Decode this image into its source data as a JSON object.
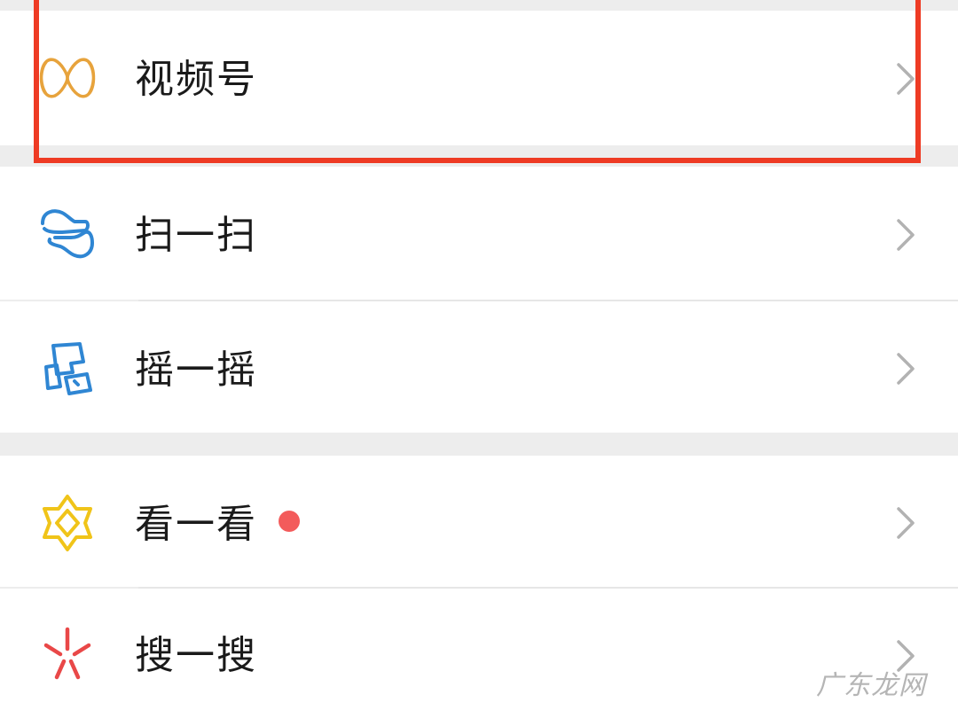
{
  "menu": {
    "items": [
      {
        "label": "视频号",
        "icon": "channels-icon"
      },
      {
        "label": "扫一扫",
        "icon": "scan-icon"
      },
      {
        "label": "摇一摇",
        "icon": "shake-icon"
      },
      {
        "label": "看一看",
        "icon": "top-stories-icon",
        "badge": "red-dot"
      },
      {
        "label": "搜一搜",
        "icon": "search-sparkle-icon"
      }
    ]
  },
  "colors": {
    "highlight_border": "#ee3b24",
    "channels_icon": "#e7a33c",
    "scan_icon": "#2f86d3",
    "shake_icon": "#2f86d3",
    "top_stories_icon": "#f0c419",
    "search_icon": "#e94848",
    "badge_dot": "#f35b5b",
    "chevron": "#b2b2b2"
  },
  "watermark": "广东龙网"
}
